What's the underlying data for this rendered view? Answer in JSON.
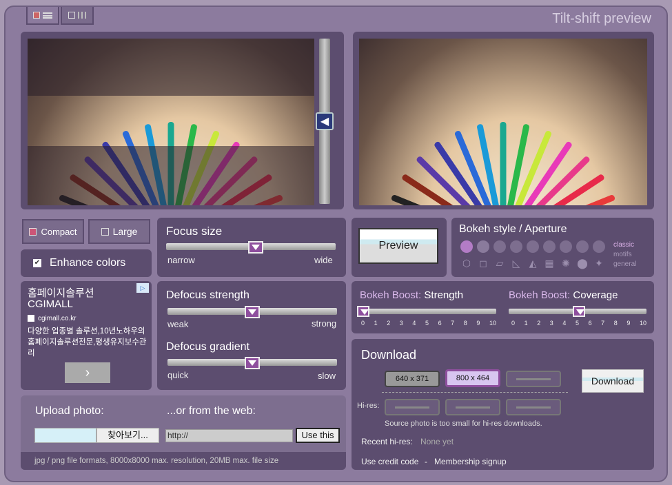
{
  "app": {
    "title": "Tilt-shift preview"
  },
  "layout_buttons": {
    "compact": "Compact",
    "large": "Large"
  },
  "enhance": {
    "label": "Enhance colors",
    "checked": true
  },
  "focus_size": {
    "title": "Focus size",
    "min_label": "narrow",
    "max_label": "wide",
    "level": 0.53
  },
  "preview": {
    "label": "Preview"
  },
  "bokeh": {
    "title": "Bokeh style / Aperture",
    "categories": [
      "classic",
      "motifs",
      "general"
    ]
  },
  "ad": {
    "headline1": "홈페이지솔루션",
    "headline2": "CGIMALL",
    "site": "cgimall.co.kr",
    "body": "다양한 업종별 솔루션,10년노하우의 홈페이지솔루션전문,평생유지보수관리",
    "next": "›"
  },
  "defocus": {
    "strength_title": "Defocus strength",
    "strength_min": "weak",
    "strength_max": "strong",
    "strength_level": 0.5,
    "gradient_title": "Defocus gradient",
    "gradient_min": "quick",
    "gradient_max": "slow",
    "gradient_level": 0.5
  },
  "boost": {
    "strength_label": "Bokeh Boost:",
    "strength_word": "Strength",
    "strength_value": 0,
    "coverage_label": "Bokeh Boost:",
    "coverage_word": "Coverage",
    "coverage_value": 5,
    "scale": [
      "0",
      "1",
      "2",
      "3",
      "4",
      "5",
      "6",
      "7",
      "8",
      "9",
      "10"
    ]
  },
  "download": {
    "title": "Download",
    "size1": "640 x 371",
    "size2": "800 x 464",
    "hires_label": "Hi-res:",
    "hires_note": "Source photo is too small for hi-res downloads.",
    "button": "Download",
    "recent_label": "Recent hi-res:",
    "recent_value": "None yet",
    "credit": "Use credit code",
    "separator": "-",
    "membership": "Membership signup"
  },
  "upload": {
    "title": "Upload photo:",
    "browse": "찾아보기...",
    "web_title": "...or from the web:",
    "url_value": "http://",
    "use_this": "Use this",
    "note": "jpg / png file formats, 8000x8000 max. resolution, 20MB max. file size"
  },
  "colors": {
    "frame": "#8c7b9e",
    "panel": "#5c4d6f",
    "accent": "#8e4f9e",
    "selected_size": "#d8c6f0"
  },
  "pens": [
    "#222",
    "#8a2a1a",
    "#5a3aa8",
    "#3a3aa8",
    "#2a6ad8",
    "#1a9ad8",
    "#1aa890",
    "#2ab84a",
    "#c8e83a",
    "#e83ab8",
    "#e83a8a",
    "#e82a4a",
    "#e83a3a"
  ]
}
